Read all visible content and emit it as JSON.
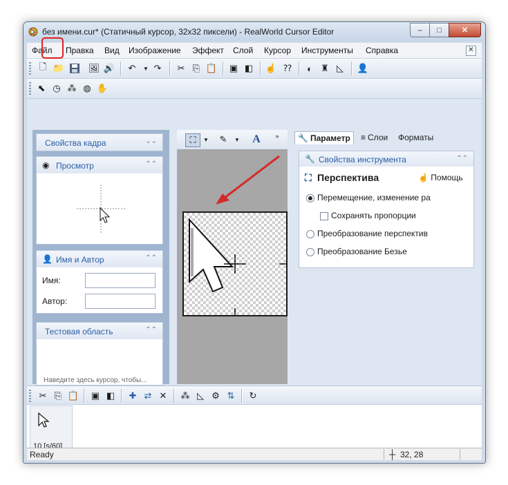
{
  "window": {
    "title": "без имени.cur* (Статичный курсор, 32x32 пиксели) - RealWorld Cursor Editor",
    "minimize": "–",
    "maximize": "□",
    "close": "✕"
  },
  "menu": {
    "items": [
      "Файл",
      "Правка",
      "Вид",
      "Изображение",
      "Эффект",
      "Слой",
      "Курсор",
      "Инструменты",
      "Справка"
    ],
    "close": "✕"
  },
  "left_panel": {
    "frame_props": "Свойства кадра",
    "preview": "Просмотр",
    "name_author": "Имя и Автор",
    "name_label": "Имя:",
    "author_label": "Автор:",
    "test_area": "Тестовая область",
    "test_hint": "Наведите здесь курсор, чтобы...",
    "name_value": "",
    "author_value": ""
  },
  "right_panel": {
    "tabs": [
      "Параметр",
      "Слои",
      "Форматы"
    ],
    "tool_props": "Свойства инструмента",
    "tool_name": "Перспектива",
    "help": "Помощь",
    "options": {
      "move_resize": "Перемещение, изменение ра",
      "keep_proportions": "Сохранять пропорции",
      "perspective": "Преобразование перспектив",
      "bezier": "Преобразование Безье"
    },
    "selected_option": "move_resize"
  },
  "frames": {
    "frame_label": "10 [s/60]"
  },
  "status": {
    "text": "Ready",
    "coords": "32, 28"
  },
  "colors": {
    "highlight": "#e02020",
    "accent": "#2a5ea8"
  }
}
